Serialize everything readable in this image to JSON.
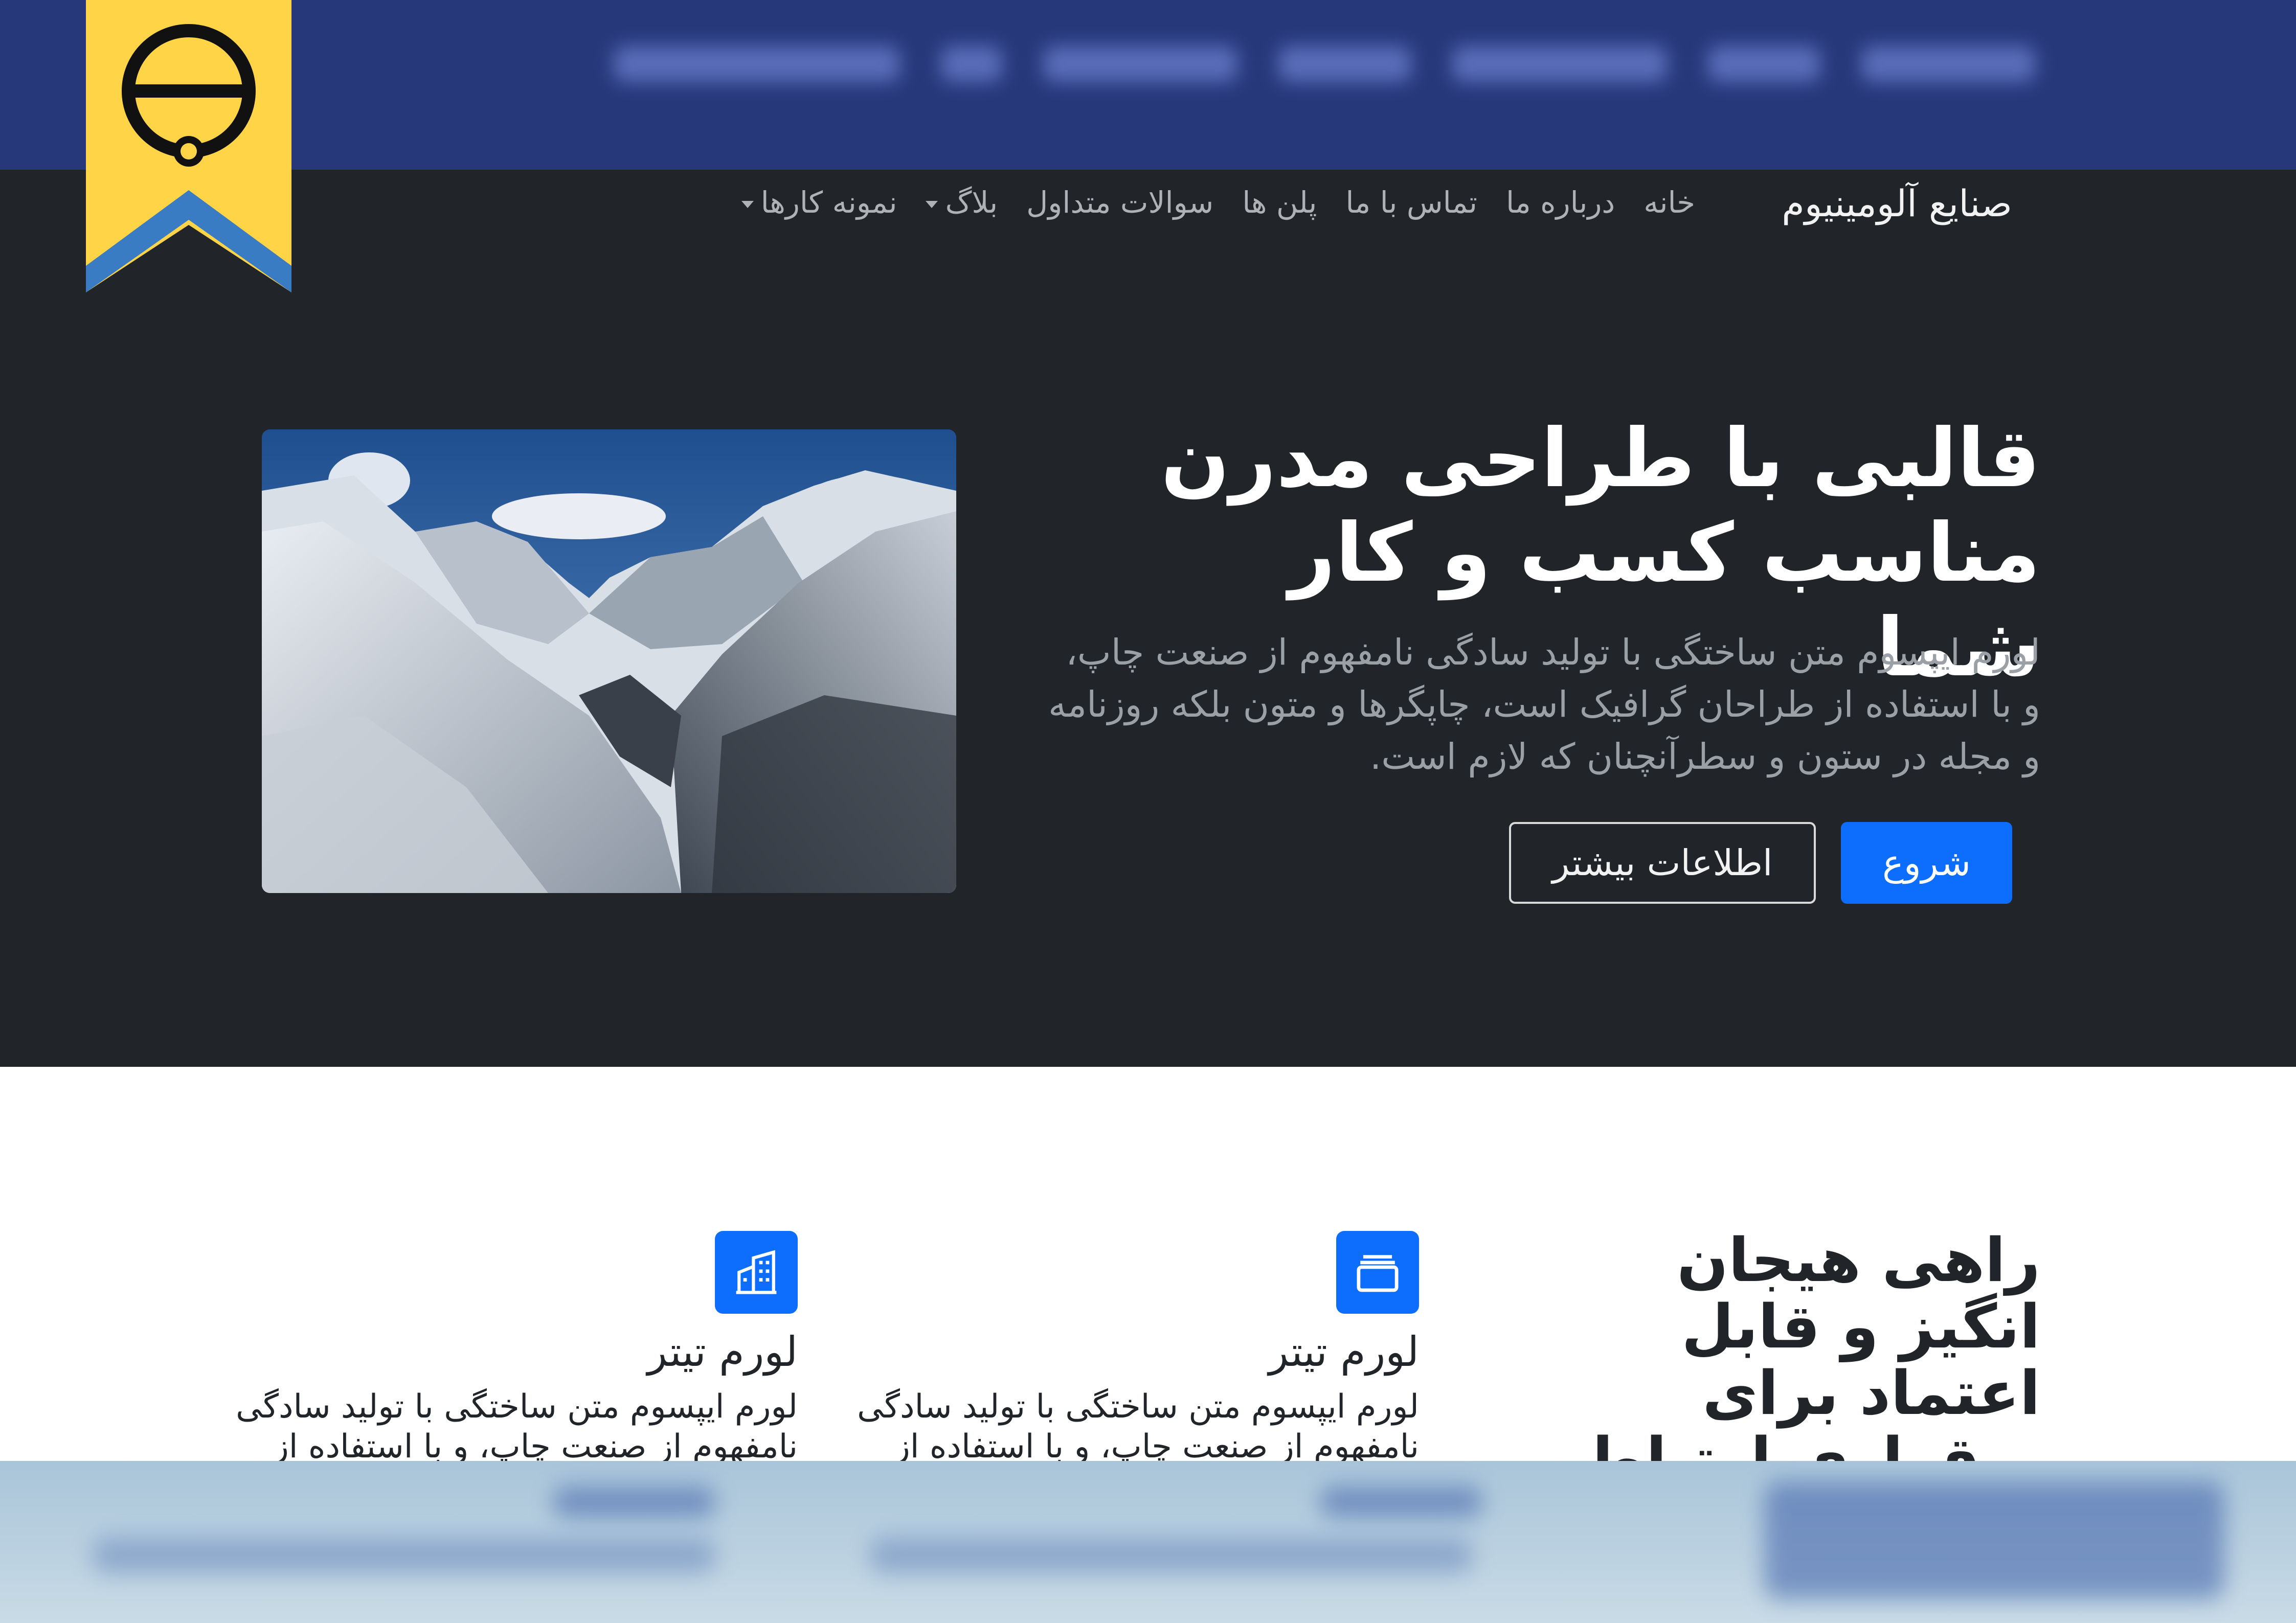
{
  "brand": "صنایع آلومینیوم",
  "nav": {
    "items": [
      {
        "label": "خانه",
        "dropdown": false
      },
      {
        "label": "درباره ما",
        "dropdown": false
      },
      {
        "label": "تماس با ما",
        "dropdown": false
      },
      {
        "label": "پلن ها",
        "dropdown": false
      },
      {
        "label": "سوالات متداول",
        "dropdown": false
      },
      {
        "label": "بلاگ",
        "dropdown": true
      },
      {
        "label": "نمونه کارها",
        "dropdown": true
      }
    ]
  },
  "hero": {
    "title_line1": "قالبی با طراحی مدرن",
    "title_line2": "مناسب کسب و کار شما",
    "text_line1": "لورم ایپسوم متن ساختگی با تولید سادگی نامفهوم از صنعت چاپ،",
    "text_line2": "و با استفاده از طراحان گرافیک است، چاپگرها و متون بلکه روزنامه",
    "text_line3": "و مجله در ستون و سطرآنچنان که لازم است.",
    "primary_button": "شروع",
    "secondary_button": "اطلاعات بیشتر"
  },
  "features": {
    "heading": "راهی هیجان انگیز و قابل اعتماد برای برقراری ارتباط با مشتری",
    "items": [
      {
        "title": "لورم تیتر",
        "text": "لورم ایپسوم متن ساختگی با تولید سادگی نامفهوم از صنعت چاپ، و با استفاده از",
        "icon": "collection-icon"
      },
      {
        "title": "لورم تیتر",
        "text": "لورم ایپسوم متن ساختگی با تولید سادگی نامفهوم از صنعت چاپ، و با استفاده از",
        "icon": "building-icon"
      }
    ]
  },
  "colors": {
    "top_strip": "#27387a",
    "navbar_bg": "#212529",
    "accent": "#0d6efd",
    "ribbon_yellow": "#ffd447",
    "ribbon_blue": "#3a7cc4"
  }
}
